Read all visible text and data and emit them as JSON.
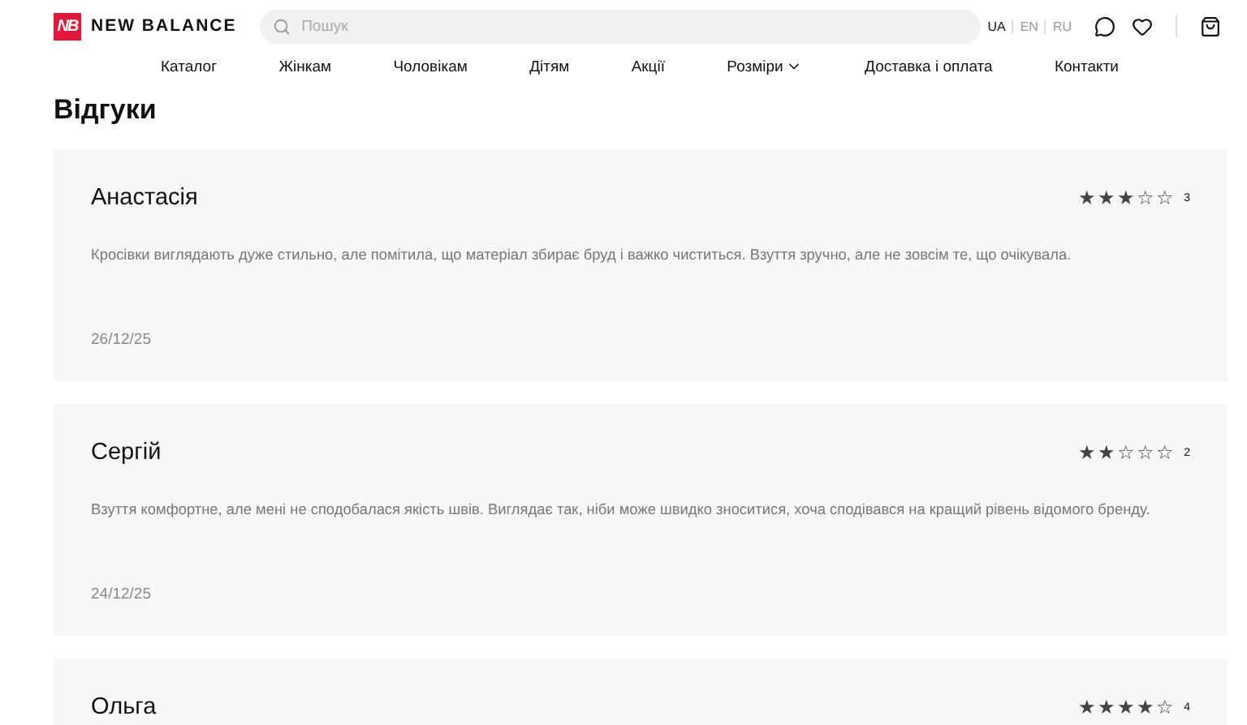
{
  "header": {
    "logo_mark": "NB",
    "brand": "NEW BALANCE",
    "search": {
      "placeholder": "Пошук"
    },
    "languages": [
      {
        "label": "UA",
        "selected": true
      },
      {
        "label": "EN",
        "selected": false
      },
      {
        "label": "RU",
        "selected": false
      }
    ]
  },
  "nav": [
    {
      "label": "Каталог",
      "dropdown": false
    },
    {
      "label": "Жінкам",
      "dropdown": false
    },
    {
      "label": "Чоловікам",
      "dropdown": false
    },
    {
      "label": "Дітям",
      "dropdown": false
    },
    {
      "label": "Акції",
      "dropdown": false
    },
    {
      "label": "Розміри",
      "dropdown": true
    },
    {
      "label": "Доставка і оплата",
      "dropdown": false
    },
    {
      "label": "Контакти",
      "dropdown": false
    }
  ],
  "title": "Відгуки",
  "reviews": [
    {
      "name": "Анастасія",
      "stars": 3,
      "rating": "3",
      "text": "Кросівки виглядають дуже стильно, але помітила, що матеріал збирає бруд і важко чиститься. Взуття зручно, але не зовсім те, що очікувала.",
      "date": "26/12/25"
    },
    {
      "name": "Сергій",
      "stars": 2,
      "rating": "2",
      "text": "Взуття комфортне, але мені не сподобалася якість швів. Виглядає так, ніби може швидко зноситися, хоча сподівався на кращий рівень відомого бренду.",
      "date": "24/12/25"
    },
    {
      "name": "Ольга",
      "stars": 4,
      "rating": "4"
    }
  ]
}
